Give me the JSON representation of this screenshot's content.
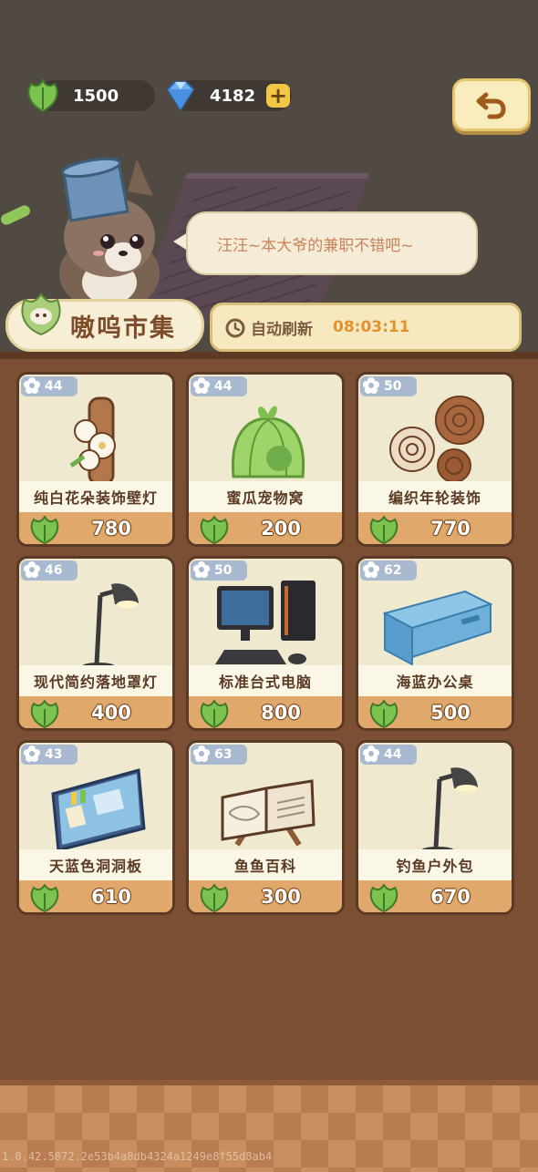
{
  "currency": {
    "leaves": "1500",
    "gems": "4182",
    "add_icon": "plus-icon"
  },
  "speech": "汪汪~本大爷的兼职不错吧~",
  "market": {
    "title": "嗷呜市集",
    "refresh_label": "自动刷新",
    "refresh_time": "08:03:11"
  },
  "items": [
    {
      "level": "44",
      "name": "纯白花朵装饰壁灯",
      "price": "780"
    },
    {
      "level": "44",
      "name": "蜜瓜宠物窝",
      "price": "200"
    },
    {
      "level": "50",
      "name": "编织年轮装饰",
      "price": "770"
    },
    {
      "level": "46",
      "name": "现代简约落地罩灯",
      "price": "400"
    },
    {
      "level": "50",
      "name": "标准台式电脑",
      "price": "800"
    },
    {
      "level": "62",
      "name": "海蓝办公桌",
      "price": "500"
    },
    {
      "level": "43",
      "name": "天蓝色洞洞板",
      "price": "610"
    },
    {
      "level": "63",
      "name": "鱼鱼百科",
      "price": "300"
    },
    {
      "level": "44",
      "name": "钓鱼户外包",
      "price": "670"
    }
  ],
  "footer": "1.0.42.5872.2e53b4a8db4324a1249e8f55d8ab4",
  "colors": {
    "leaf": "#7cc24f",
    "gem": "#5a9be6",
    "price_band": "#e0a86a",
    "level_tag": "#a9b9cf"
  }
}
